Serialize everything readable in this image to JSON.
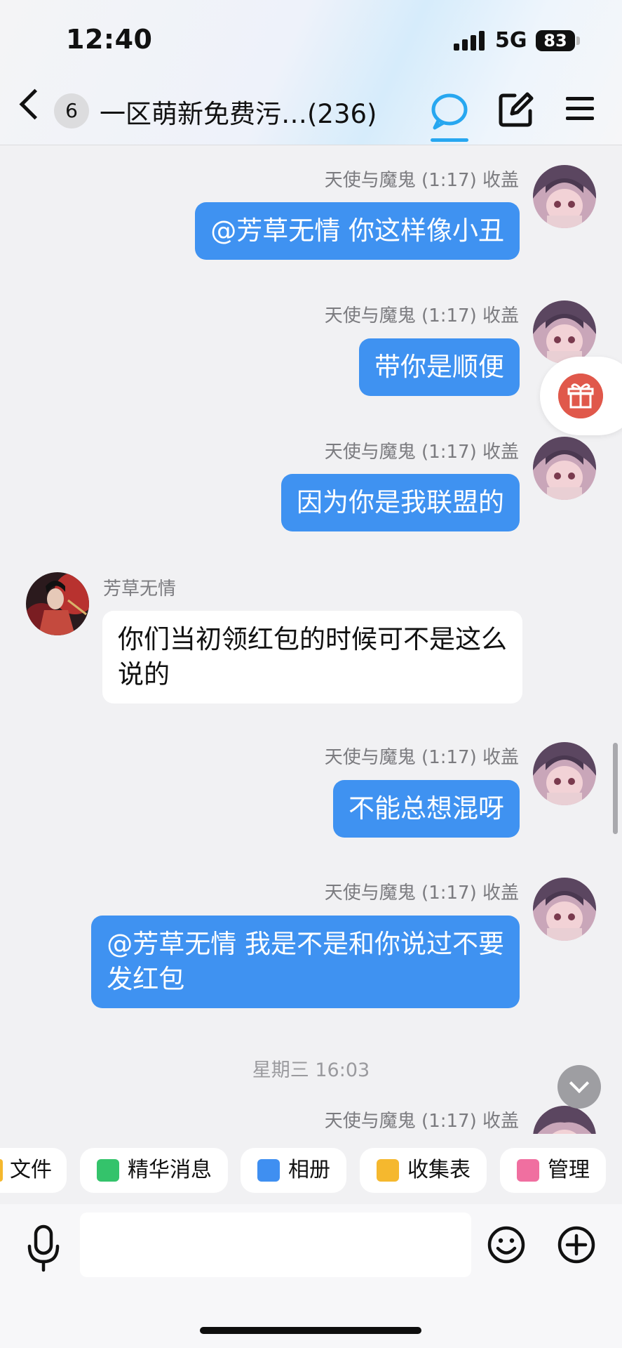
{
  "status_bar": {
    "time": "12:40",
    "network": "5G",
    "battery": "83"
  },
  "header": {
    "back_badge": "6",
    "title": "一区萌新免费污…(236)"
  },
  "messages": [
    {
      "sender": "天使与魔鬼 (1:17) 收盖",
      "text": "@芳草无情 你这样像小丑"
    },
    {
      "sender": "天使与魔鬼 (1:17) 收盖",
      "text": "带你是顺便"
    },
    {
      "sender": "天使与魔鬼 (1:17) 收盖",
      "text": "因为你是我联盟的"
    },
    {
      "sender": "芳草无情",
      "line1": "你们当初领红包的时候可不是这么",
      "line2": "说的"
    },
    {
      "sender": "天使与魔鬼 (1:17) 收盖",
      "text": "不能总想混呀"
    },
    {
      "sender": "天使与魔鬼 (1:17) 收盖",
      "line1": "@芳草无情 我是不是和你说过不要",
      "line2": "发红包"
    },
    {
      "sender": "天使与魔鬼 (1:17) 收盖"
    }
  ],
  "date_separator": "星期三 16:03",
  "quick_bar": [
    {
      "label": "文件",
      "icon": "file-icon"
    },
    {
      "label": "精华消息",
      "icon": "essence-icon",
      "color": "#34c36b"
    },
    {
      "label": "相册",
      "icon": "album-icon",
      "color": "#3f8ff1"
    },
    {
      "label": "收集表",
      "icon": "form-icon",
      "color": "#f5b82e"
    },
    {
      "label": "管理",
      "icon": "manage-icon",
      "color": "#f06fa0"
    }
  ],
  "input": {
    "value": "",
    "placeholder": ""
  },
  "colors": {
    "outgoing_bubble": "#3f92f1",
    "incoming_bubble": "#ffffff",
    "accent": "#27a7f0",
    "gift": "#e0584b"
  }
}
